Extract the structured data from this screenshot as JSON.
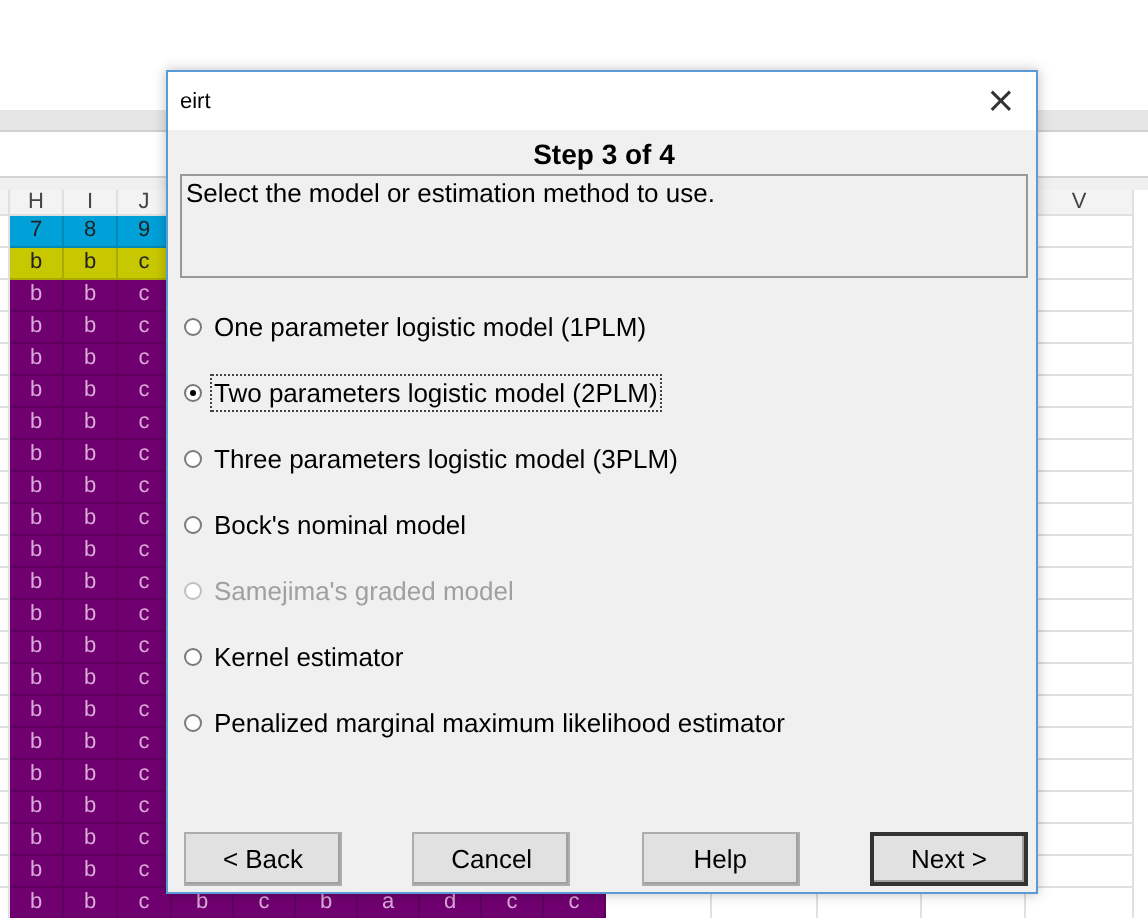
{
  "spreadsheet": {
    "column_headers": [
      "H",
      "I",
      "J",
      "V"
    ],
    "rows": [
      {
        "color": "#00a0d8",
        "cells": [
          "7",
          "8",
          "9"
        ]
      },
      {
        "color": "#c8c800",
        "cells": [
          "b",
          "b",
          "c"
        ]
      },
      {
        "color": "#700070",
        "cells": [
          "b",
          "b",
          "c"
        ]
      },
      {
        "color": "#700070",
        "cells": [
          "b",
          "b",
          "c"
        ]
      },
      {
        "color": "#700070",
        "cells": [
          "b",
          "b",
          "c"
        ]
      },
      {
        "color": "#700070",
        "cells": [
          "b",
          "b",
          "c"
        ]
      },
      {
        "color": "#700070",
        "cells": [
          "b",
          "b",
          "c"
        ]
      },
      {
        "color": "#700070",
        "cells": [
          "b",
          "b",
          "c"
        ]
      },
      {
        "color": "#700070",
        "cells": [
          "b",
          "b",
          "c"
        ]
      },
      {
        "color": "#700070",
        "cells": [
          "b",
          "b",
          "c"
        ]
      },
      {
        "color": "#700070",
        "cells": [
          "b",
          "b",
          "c"
        ]
      },
      {
        "color": "#700070",
        "cells": [
          "b",
          "b",
          "c"
        ]
      },
      {
        "color": "#700070",
        "cells": [
          "b",
          "b",
          "c"
        ]
      },
      {
        "color": "#700070",
        "cells": [
          "b",
          "b",
          "c"
        ]
      },
      {
        "color": "#700070",
        "cells": [
          "b",
          "b",
          "c"
        ]
      },
      {
        "color": "#700070",
        "cells": [
          "b",
          "b",
          "c"
        ]
      },
      {
        "color": "#700070",
        "cells": [
          "b",
          "b",
          "c"
        ]
      },
      {
        "color": "#700070",
        "cells": [
          "b",
          "b",
          "c"
        ]
      },
      {
        "color": "#700070",
        "cells": [
          "b",
          "b",
          "c"
        ]
      },
      {
        "color": "#700070",
        "cells": [
          "b",
          "b",
          "c"
        ]
      },
      {
        "color": "#700070",
        "cells": [
          "b",
          "b",
          "c"
        ]
      },
      {
        "color": "#700070",
        "cells": [
          "b",
          "b",
          "c",
          "b",
          "c",
          "b",
          "a",
          "d",
          "c",
          "c"
        ]
      }
    ]
  },
  "dialog": {
    "title": "eirt",
    "close": "×",
    "step": "Step 3 of 4",
    "description": "Select the model or estimation method to use.",
    "options": [
      {
        "label": "One parameter logistic model (1PLM)",
        "selected": false,
        "disabled": false
      },
      {
        "label": "Two parameters logistic model (2PLM)",
        "selected": true,
        "disabled": false
      },
      {
        "label": "Three parameters logistic model (3PLM)",
        "selected": false,
        "disabled": false
      },
      {
        "label": "Bock's nominal model",
        "selected": false,
        "disabled": false
      },
      {
        "label": "Samejima's graded model",
        "selected": false,
        "disabled": true
      },
      {
        "label": "Kernel estimator",
        "selected": false,
        "disabled": false
      },
      {
        "label": "Penalized marginal maximum likelihood estimator",
        "selected": false,
        "disabled": false
      }
    ],
    "buttons": [
      {
        "label": "< Back",
        "default": false
      },
      {
        "label": "Cancel",
        "default": false
      },
      {
        "label": "Help",
        "default": false
      },
      {
        "label": "Next >",
        "default": true
      }
    ]
  }
}
